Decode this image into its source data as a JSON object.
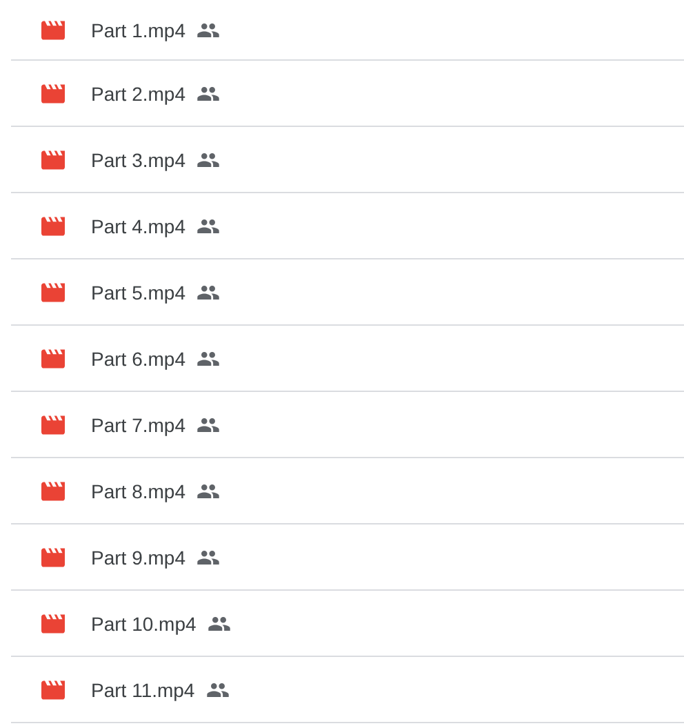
{
  "files": [
    {
      "name": "Part 1.mp4",
      "shared": true
    },
    {
      "name": "Part 2.mp4",
      "shared": true
    },
    {
      "name": "Part 3.mp4",
      "shared": true
    },
    {
      "name": "Part 4.mp4",
      "shared": true
    },
    {
      "name": "Part 5.mp4",
      "shared": true
    },
    {
      "name": "Part 6.mp4",
      "shared": true
    },
    {
      "name": "Part 7.mp4",
      "shared": true
    },
    {
      "name": "Part 8.mp4",
      "shared": true
    },
    {
      "name": "Part 9.mp4",
      "shared": true
    },
    {
      "name": "Part 10.mp4",
      "shared": true
    },
    {
      "name": "Part 11.mp4",
      "shared": true
    }
  ]
}
